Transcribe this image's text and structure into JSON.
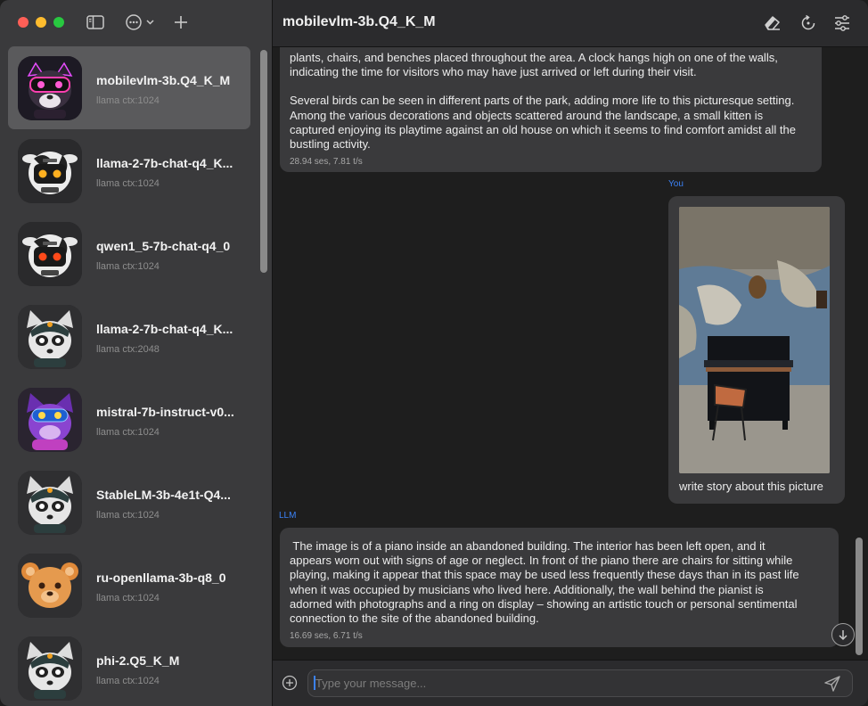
{
  "header": {
    "title": "mobilevlm-3b.Q4_K_M"
  },
  "toolbar": {
    "sidebar_toggle_icon": "sidebar-icon",
    "more_icon": "ellipsis-circle-icon",
    "new_chat_icon": "plus-icon",
    "clear_icon": "eraser-icon",
    "reload_icon": "reload-icon",
    "settings_icon": "sliders-icon"
  },
  "chats": [
    {
      "title": "mobilevlm-3b.Q4_K_M",
      "subtitle": "llama ctx:1024",
      "selected": true,
      "avatar": "robot-pink"
    },
    {
      "title": "llama-2-7b-chat-q4_K...",
      "subtitle": "llama ctx:1024",
      "selected": false,
      "avatar": "robot-cow"
    },
    {
      "title": "qwen1_5-7b-chat-q4_0",
      "subtitle": "llama ctx:1024",
      "selected": false,
      "avatar": "robot-cow"
    },
    {
      "title": "llama-2-7b-chat-q4_K...",
      "subtitle": "llama ctx:2048",
      "selected": false,
      "avatar": "raccoon"
    },
    {
      "title": "mistral-7b-instruct-v0...",
      "subtitle": "llama ctx:1024",
      "selected": false,
      "avatar": "purple-cat"
    },
    {
      "title": "StableLM-3b-4e1t-Q4...",
      "subtitle": "llama ctx:1024",
      "selected": false,
      "avatar": "raccoon"
    },
    {
      "title": "ru-openllama-3b-q8_0",
      "subtitle": "llama ctx:1024",
      "selected": false,
      "avatar": "bear"
    },
    {
      "title": "phi-2.Q5_K_M",
      "subtitle": "llama ctx:1024",
      "selected": false,
      "avatar": "raccoon"
    }
  ],
  "messages": {
    "first": {
      "lines": [
        "plants, chairs, and benches placed throughout the area. A clock hangs high on one of the walls,",
        "indicating the time for visitors who may have just arrived or left during their visit."
      ],
      "lines2": [
        "Several birds can be seen in different parts of the park, adding more life to this picturesque setting.",
        "Among the various decorations and objects scattered around the landscape, a small kitten is",
        "captured enjoying its playtime against an old house on which it seems to find comfort amidst all the",
        "bustling activity."
      ],
      "meta": "28.94 ses, 7.81 t/s"
    },
    "user": {
      "sender": "You",
      "text": "write story about this picture",
      "image": "photo of a piano in an abandoned building"
    },
    "llm": {
      "sender": "LLM",
      "lines": [
        " The image is of a piano inside an abandoned building. The interior has been left open, and it",
        "appears worn out with signs of age or neglect. In front of the piano there are chairs for sitting while",
        "playing, making it appear that this space may be used less frequently these days than in its past life",
        "when it was occupied by musicians who lived here. Additionally, the wall behind the pianist is",
        "adorned with photographs and a ring on display – showing an artistic touch or personal sentimental",
        "connection to the site of the abandoned building."
      ],
      "meta": "16.69 ses, 6.71 t/s"
    }
  },
  "composer": {
    "placeholder": "Type your message...",
    "attach_icon": "plus-circle-icon",
    "send_icon": "send-icon",
    "scroll_down_icon": "arrow-down-circle-icon"
  },
  "colors": {
    "accent": "#3b82f6",
    "sidebar_bg": "#3a3a3c",
    "main_bg": "#1e1e1e",
    "bubble_bg": "#3a3a3c"
  }
}
